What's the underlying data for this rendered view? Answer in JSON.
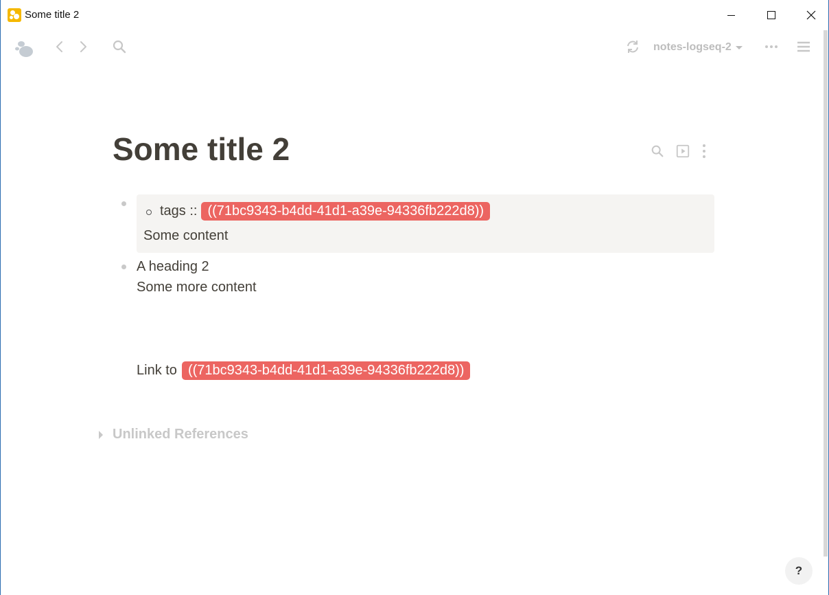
{
  "window": {
    "title": "Some title 2"
  },
  "toolbar": {
    "graph_name": "notes-logseq-2"
  },
  "page": {
    "title": "Some title 2",
    "blocks": [
      {
        "property_key": "tags ::",
        "property_ref": "((71bc9343-b4dd-41d1-a39e-94336fb222d8))",
        "content": "Some content"
      },
      {
        "heading": "A heading 2",
        "content": "Some more content",
        "link_label": "Link to",
        "link_ref": "((71bc9343-b4dd-41d1-a39e-94336fb222d8))"
      }
    ],
    "unlinked_references": "Unlinked References"
  },
  "help": {
    "label": "?"
  },
  "colors": {
    "accent_ref": "#ec6561",
    "text": "#433f38",
    "muted": "#c7c7c7",
    "card_bg": "#f5f4f2"
  },
  "icons": [
    "logseq-logo-icon",
    "back-arrow-icon",
    "forward-arrow-icon",
    "search-icon",
    "sync-icon",
    "more-horizontal-icon",
    "menu-icon",
    "page-search-icon",
    "slides-icon",
    "more-vertical-icon",
    "triangle-right-icon"
  ]
}
